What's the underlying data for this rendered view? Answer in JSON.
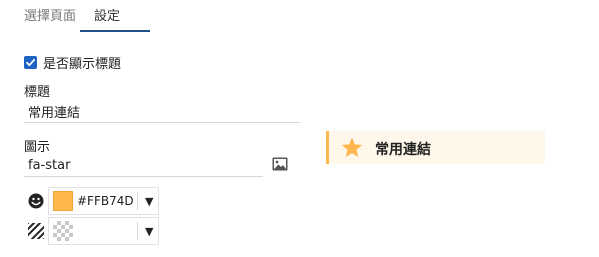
{
  "tabs": [
    {
      "label": "選擇頁面",
      "active": false
    },
    {
      "label": "設定",
      "active": true
    }
  ],
  "settings": {
    "show_title": {
      "label": "是否顯示標題",
      "checked": true
    },
    "title": {
      "label": "標題",
      "value": "常用連結"
    },
    "icon": {
      "label": "圖示",
      "value": "fa-star",
      "picker_icon": "image-icon"
    },
    "foreground_color": {
      "icon": "smile-icon",
      "value": "#FFB74D",
      "display": "#FFB74D"
    },
    "background_color": {
      "icon": "hatch-icon",
      "value": "",
      "display": ""
    }
  },
  "preview": {
    "icon": "star-icon",
    "title": "常用連結",
    "accent": "#FFB74D"
  }
}
